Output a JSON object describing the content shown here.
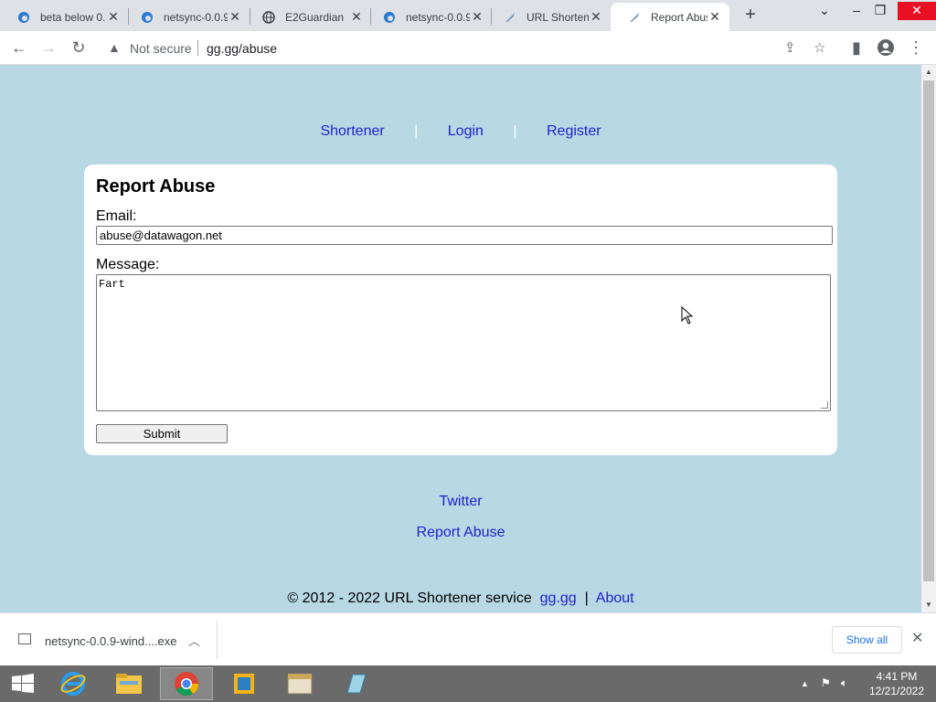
{
  "tabs": [
    {
      "title": "beta below 0.1",
      "icon": "edge-icon"
    },
    {
      "title": "netsync-0.0.9",
      "icon": "edge-icon"
    },
    {
      "title": "E2Guardian",
      "icon": "globe-icon"
    },
    {
      "title": "netsync-0.0.9",
      "icon": "edge-icon"
    },
    {
      "title": "URL Shortener",
      "icon": "rocket-icon"
    },
    {
      "title": "Report Abuse",
      "icon": "rocket-icon"
    }
  ],
  "toolbar": {
    "security_label": "Not secure",
    "url": "gg.gg/abuse"
  },
  "nav": {
    "shortener": "Shortener",
    "login": "Login",
    "register": "Register",
    "separator": "|"
  },
  "form": {
    "heading": "Report Abuse",
    "email_label": "Email:",
    "email_value": "abuse@datawagon.net",
    "message_label": "Message:",
    "message_value": "Fart",
    "submit_label": "Submit"
  },
  "footer": {
    "twitter": "Twitter",
    "report_abuse": "Report Abuse",
    "copyright": "© 2012 - 2022 URL Shortener service",
    "site_link": "gg.gg",
    "pipe": "|",
    "about": "About"
  },
  "download": {
    "filename": "netsync-0.0.9-wind....exe",
    "show_all": "Show all"
  },
  "taskbar": {
    "time": "4:41 PM",
    "date": "12/21/2022"
  },
  "colors": {
    "page_bg": "#b8d8e4",
    "link": "#2222cc"
  }
}
